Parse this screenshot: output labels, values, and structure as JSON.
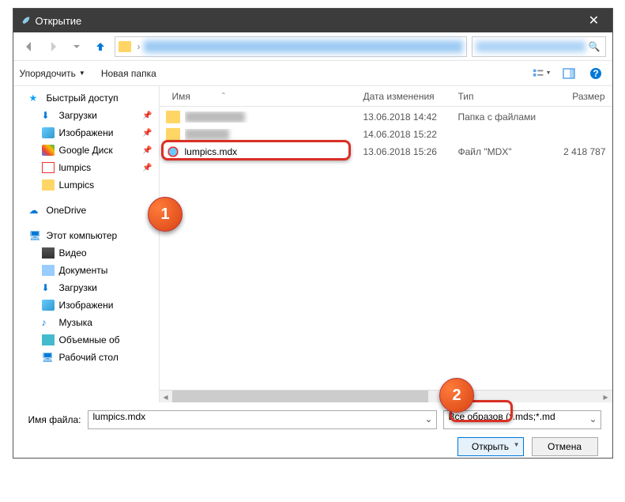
{
  "titlebar": {
    "title": "Открытие"
  },
  "toolbar": {
    "organize": "Упорядочить",
    "newfolder": "Новая папка"
  },
  "columns": {
    "name": "Имя",
    "date": "Дата изменения",
    "type": "Тип",
    "size": "Размер"
  },
  "sidebar": {
    "quick": "Быстрый доступ",
    "downloads": "Загрузки",
    "images": "Изображени",
    "gdrive": "Google Диск",
    "lumpics1": "lumpics",
    "lumpics2": "Lumpics",
    "onedrive": "OneDrive",
    "thispc": "Этот компьютер",
    "video": "Видео",
    "documents": "Документы",
    "downloads2": "Загрузки",
    "images2": "Изображени",
    "music": "Музыка",
    "objects3d": "Объемные об",
    "desktop": "Рабочий стол"
  },
  "files": [
    {
      "name": "",
      "date": "13.06.2018 14:42",
      "type": "Папка с файлами",
      "size": ""
    },
    {
      "name": "",
      "date": "14.06.2018 15:22",
      "type": "",
      "size": ""
    },
    {
      "name": "lumpics.mdx",
      "date": "13.06.2018 15:26",
      "type": "Файл \"MDX\"",
      "size": "2 418 787"
    }
  ],
  "bottom": {
    "filenameLabel": "Имя файла:",
    "filenameValue": "lumpics.mdx",
    "filterLabel": "Все         образов (*.mds;*.md",
    "openBtn": "Открыть",
    "cancelBtn": "Отмена"
  },
  "markers": {
    "one": "1",
    "two": "2"
  }
}
